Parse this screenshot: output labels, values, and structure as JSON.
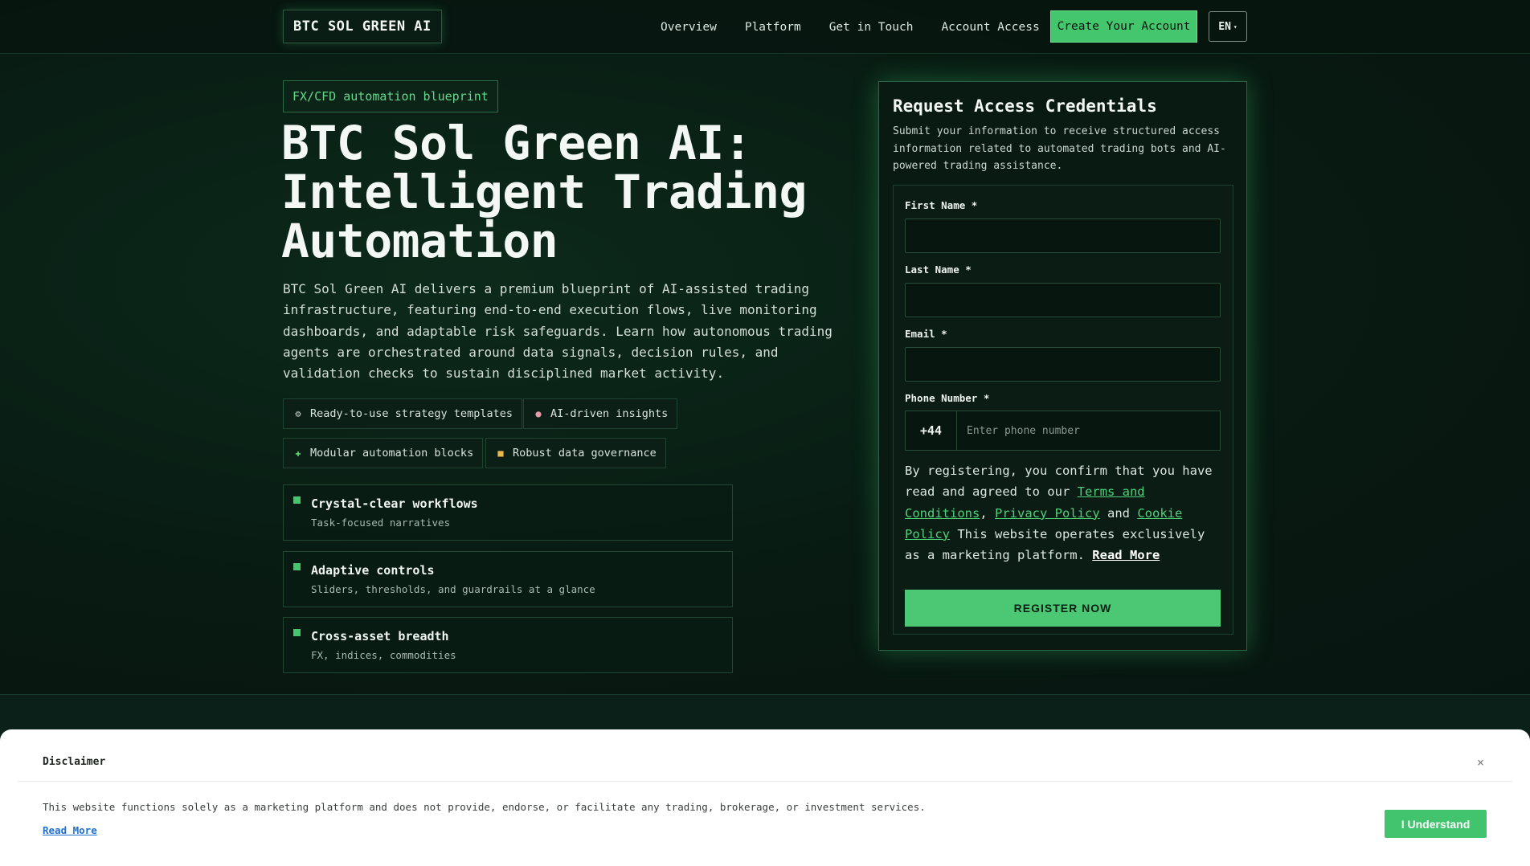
{
  "header": {
    "logo": "BTC SOL GREEN AI",
    "nav": [
      "Overview",
      "Platform",
      "Get in Touch",
      "Account Access"
    ],
    "cta": "Create Your Account",
    "lang": "EN"
  },
  "hero": {
    "badge": "FX/CFD automation blueprint",
    "title_lines": [
      "BTC Sol Green AI:",
      "Intelligent Trading",
      "Automation"
    ],
    "description": "BTC Sol Green AI delivers a premium blueprint of AI-assisted trading infrastructure, featuring end-to-end execution flows, live monitoring dashboards, and adaptable risk safeguards. Learn how autonomous trading agents are orchestrated around data signals, decision rules, and validation checks to sustain disciplined market activity.",
    "chips": [
      {
        "icon": "gear-icon",
        "label": "Ready-to-use strategy templates"
      },
      {
        "icon": "brain-icon",
        "label": "AI-driven insights"
      },
      {
        "icon": "puzzle-icon",
        "label": "Modular automation blocks"
      },
      {
        "icon": "lock-icon",
        "label": "Robust data governance"
      }
    ],
    "features": [
      {
        "title": "Crystal-clear workflows",
        "subtitle": "Task-focused narratives"
      },
      {
        "title": "Adaptive controls",
        "subtitle": "Sliders, thresholds, and guardrails at a glance"
      },
      {
        "title": "Cross-asset breadth",
        "subtitle": "FX, indices, commodities"
      }
    ]
  },
  "form": {
    "title": "Request Access Credentials",
    "subtitle": "Submit your information to receive structured access information related to automated trading bots and AI-powered trading assistance.",
    "first_name_label": "First Name *",
    "last_name_label": "Last Name *",
    "email_label": "Email *",
    "phone_label": "Phone Number *",
    "phone_prefix": "+44",
    "phone_placeholder": "Enter phone number",
    "consent_pre": "By registering, you confirm that you have read and agreed to our ",
    "terms_link": "Terms and Conditions",
    "sep1": ", ",
    "privacy_link": "Privacy Policy",
    "and": " and ",
    "cookie_link": "Cookie Policy",
    "consent_post": " This website operates exclusively as a marketing platform. ",
    "read_more": "Read More",
    "submit": "REGISTER NOW"
  },
  "disclaimer": {
    "title": "Disclaimer",
    "close": "×",
    "text": "This website functions solely as a marketing platform and does not provide, endorse, or facilitate any trading, brokerage, or investment services.",
    "read_more": "Read More",
    "accept": "I Understand"
  },
  "colors": {
    "accent": "#44c66d",
    "background": "#071710",
    "link": "#4fd17a"
  }
}
